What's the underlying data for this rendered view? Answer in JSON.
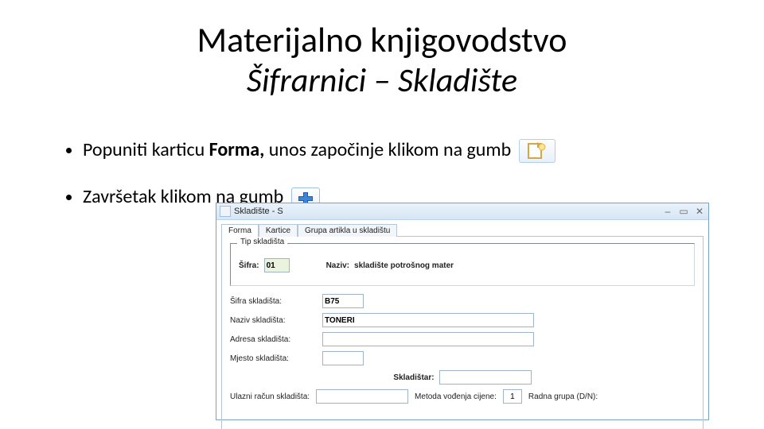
{
  "title": "Materijalno knjigovodstvo",
  "subtitle": "Šifrarnici – Skladište",
  "bullets": [
    {
      "pre": "Popuniti karticu ",
      "strong": "Forma, ",
      "post": "unos započinje klikom na gumb"
    },
    {
      "text": "Završetak klikom na gumb"
    }
  ],
  "window": {
    "title": "Skladište - S",
    "tabs": [
      "Forma",
      "Kartice",
      "Grupa artikla u skladištu"
    ],
    "group": {
      "title": "Tip skladišta",
      "sifra_label": "Šifra:",
      "sifra_value": "01",
      "naziv_label": "Naziv:",
      "naziv_value": "skladište potrošnog mater"
    },
    "fields": {
      "sifra_skladista": {
        "label": "Šifra skladišta:",
        "value": "B75"
      },
      "naziv_skladista": {
        "label": "Naziv skladišta:",
        "value": "TONERI"
      },
      "adresa_skladista": {
        "label": "Adresa skladišta:"
      },
      "mjesto_skladista": {
        "label": "Mjesto skladišta:"
      },
      "skladistar": {
        "label": "Skladištar:"
      },
      "ulazni_racun": {
        "label": "Ulazni račun skladišta:"
      },
      "metoda": {
        "label": "Metoda vođenja cijene:",
        "value": "1"
      },
      "radna_grupa": {
        "label": "Radna grupa (D/N):"
      }
    }
  }
}
